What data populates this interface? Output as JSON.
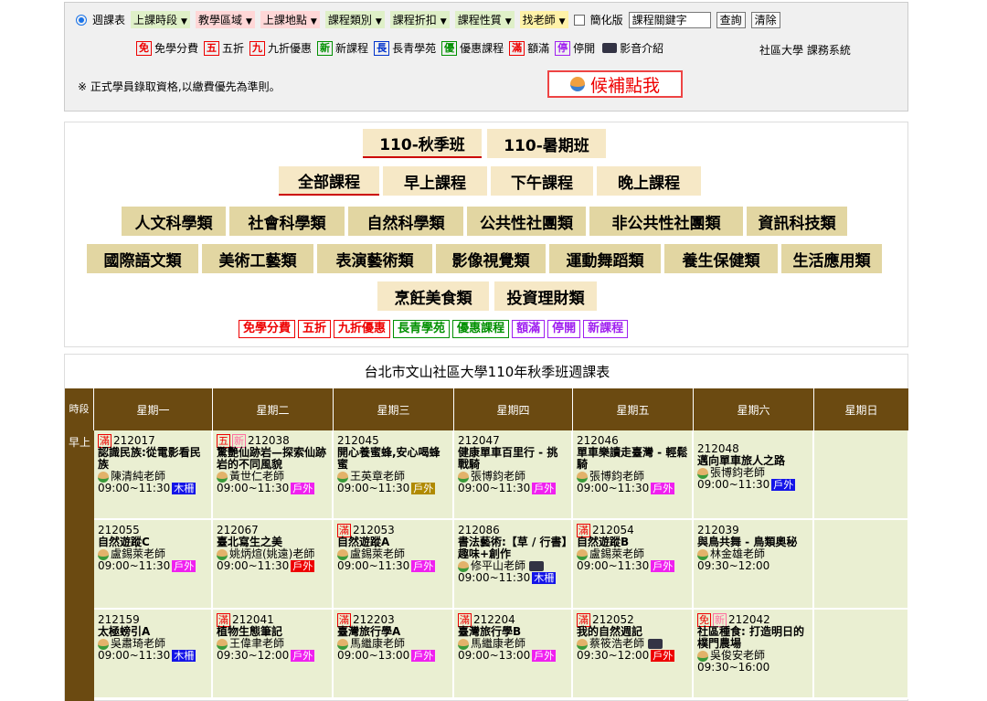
{
  "filters": {
    "weekly_label": "週課表",
    "dropdowns": [
      {
        "label": "上課時段",
        "color": "g"
      },
      {
        "label": "教學區域",
        "color": ""
      },
      {
        "label": "上課地點",
        "color": ""
      },
      {
        "label": "課程類別",
        "color": "g"
      },
      {
        "label": "課程折扣",
        "color": "g"
      },
      {
        "label": "課程性質",
        "color": "g"
      },
      {
        "label": "找老師",
        "color": "y"
      }
    ],
    "simplified_label": "簡化版",
    "keyword_value": "課程關鍵字",
    "query_btn": "查詢",
    "clear_btn": "清除"
  },
  "legend_top": {
    "items": [
      {
        "tag": "免",
        "text": "免學分費",
        "cls": "t-red"
      },
      {
        "tag": "五",
        "text": "五折",
        "cls": "t-red"
      },
      {
        "tag": "九",
        "text": "九折優惠",
        "cls": "t-red"
      },
      {
        "tag": "新",
        "text": "新課程",
        "cls": "t-green"
      },
      {
        "tag": "長",
        "text": "長青學苑",
        "cls": "t-blue"
      },
      {
        "tag": "優",
        "text": "優惠課程",
        "cls": "t-green"
      },
      {
        "tag": "滿",
        "text": "額滿",
        "cls": "t-red"
      },
      {
        "tag": "停",
        "text": "停開",
        "cls": "t-pur"
      }
    ],
    "video_label": "影音介紹",
    "system_name": "社區大學 課務系統"
  },
  "note": "※ 正式學員錄取資格,以繳費優先為準則。",
  "waitlist_label": "候補點我",
  "semesters": [
    "110-秋季班",
    "110-暑期班"
  ],
  "times": [
    "全部課程",
    "早上課程",
    "下午課程",
    "晚上課程"
  ],
  "categories_row1": [
    "人文科學類",
    "社會科學類",
    "自然科學類",
    "公共性社團類",
    "非公共性社團類",
    "資訊科技類"
  ],
  "categories_row2": [
    "國際語文類",
    "美術工藝類",
    "表演藝術類",
    "影像視覺類",
    "運動舞蹈類",
    "養生保健類",
    "生活應用類"
  ],
  "categories_row3": [
    "烹飪美食類",
    "投資理財類"
  ],
  "legend_bottom": [
    {
      "text": "免學分費",
      "cls": "t-red"
    },
    {
      "text": "五折",
      "cls": "t-red"
    },
    {
      "text": "九折優惠",
      "cls": "t-red"
    },
    {
      "text": "長青學苑",
      "cls": "t-green"
    },
    {
      "text": "優惠課程",
      "cls": "t-green"
    },
    {
      "text": "額滿",
      "cls": "t-pur"
    },
    {
      "text": "停開",
      "cls": "t-pur"
    },
    {
      "text": "新課程",
      "cls": "t-pur"
    }
  ],
  "table": {
    "title": "台北市文山社區大學110年秋季班週課表",
    "period_header": "時段",
    "days": [
      "星期一",
      "星期二",
      "星期三",
      "星期四",
      "星期五",
      "星期六",
      "星期日"
    ],
    "period_morning": "早上",
    "rows": [
      [
        {
          "tags": [
            {
              "t": "滿",
              "c": "t-red"
            }
          ],
          "id": "212017",
          "name": "認識民族:從電影看民族",
          "teacher": "陳清純老師",
          "time": "09:00~11:30",
          "loc": "木柵",
          "locc": "l-blue"
        },
        {
          "tags": [
            {
              "t": "五",
              "c": "t-red"
            },
            {
              "t": "新",
              "c": "t-pink"
            }
          ],
          "id": "212038",
          "name": "驚艷仙跡岩—探索仙跡岩的不同風貌",
          "teacher": "黃世仁老師",
          "time": "09:00~11:30",
          "loc": "戶外",
          "locc": "l-out"
        },
        {
          "tags": [],
          "id": "212045",
          "name": "開心養蜜蜂,安心喝蜂蜜",
          "teacher": "王英章老師",
          "time": "09:00~11:30",
          "loc": "戶外",
          "locc": "l-olive"
        },
        {
          "tags": [],
          "id": "212047",
          "name": "健康單車百里行 - 挑戰騎",
          "teacher": "張博鈞老師",
          "time": "09:00~11:30",
          "loc": "戶外",
          "locc": "l-out"
        },
        {
          "tags": [],
          "id": "212046",
          "name": "單車樂讀走臺灣 - 輕鬆騎",
          "teacher": "張博鈞老師",
          "time": "09:00~11:30",
          "loc": "戶外",
          "locc": "l-out"
        },
        {
          "tags": [],
          "id": "212048",
          "name": "邁向單車旅人之路",
          "teacher": "張博鈞老師",
          "time": "09:00~11:30",
          "loc": "戶外",
          "locc": "l-blue"
        },
        null
      ],
      [
        {
          "tags": [],
          "id": "212055",
          "name": "自然遊蹤C",
          "teacher": "盧錫萊老師",
          "time": "09:00~11:30",
          "loc": "戶外",
          "locc": "l-out"
        },
        {
          "tags": [],
          "id": "212067",
          "name": "臺北寫生之美",
          "teacher": "姚炳煊(姚遠)老師",
          "time": "09:00~11:30",
          "loc": "戶外",
          "locc": "l-red"
        },
        {
          "tags": [
            {
              "t": "滿",
              "c": "t-red"
            }
          ],
          "id": "212053",
          "name": "自然遊蹤A",
          "teacher": "盧錫萊老師",
          "time": "09:00~11:30",
          "loc": "戶外",
          "locc": "l-out"
        },
        {
          "tags": [],
          "id": "212086",
          "name": "書法藝術:【草 / 行書】趣味+創作",
          "teacher": "修平山老師",
          "time": "09:00~11:30",
          "loc": "木柵",
          "locc": "l-blue",
          "cam": true
        },
        {
          "tags": [
            {
              "t": "滿",
              "c": "t-red"
            }
          ],
          "id": "212054",
          "name": "自然遊蹤B",
          "teacher": "盧錫萊老師",
          "time": "09:00~11:30",
          "loc": "戶外",
          "locc": "l-out"
        },
        {
          "tags": [],
          "id": "212039",
          "name": "與鳥共舞 - 鳥類奧秘",
          "teacher": "林金雄老師",
          "time": "09:30~12:00",
          "loc": "",
          "locc": ""
        },
        null
      ],
      [
        {
          "tags": [],
          "id": "212159",
          "name": "太極螃引A",
          "teacher": "吳肅琦老師",
          "time": "09:00~11:30",
          "loc": "木柵",
          "locc": "l-blue"
        },
        {
          "tags": [
            {
              "t": "滿",
              "c": "t-red"
            }
          ],
          "id": "212041",
          "name": "植物生態筆記",
          "teacher": "王偉聿老師",
          "time": "09:30~12:00",
          "loc": "戶外",
          "locc": "l-out"
        },
        {
          "tags": [
            {
              "t": "滿",
              "c": "t-red"
            }
          ],
          "id": "212203",
          "name": "臺灣旅行學A",
          "teacher": "馬繼康老師",
          "time": "09:00~13:00",
          "loc": "戶外",
          "locc": "l-out"
        },
        {
          "tags": [
            {
              "t": "滿",
              "c": "t-red"
            }
          ],
          "id": "212204",
          "name": "臺灣旅行學B",
          "teacher": "馬繼康老師",
          "time": "09:00~13:00",
          "loc": "戶外",
          "locc": "l-out"
        },
        {
          "tags": [
            {
              "t": "滿",
              "c": "t-red"
            }
          ],
          "id": "212052",
          "name": "我的自然週記",
          "teacher": "蔡筱浩老師",
          "time": "09:30~12:00",
          "loc": "戶外",
          "locc": "l-red",
          "cam": true
        },
        {
          "tags": [
            {
              "t": "免",
              "c": "t-red"
            },
            {
              "t": "新",
              "c": "t-pink"
            }
          ],
          "id": "212042",
          "name": "社區種食: 打造明日的樸門農場",
          "teacher": "吳俊安老師",
          "time": "09:30~16:00",
          "loc": "",
          "locc": ""
        },
        null
      ]
    ]
  }
}
